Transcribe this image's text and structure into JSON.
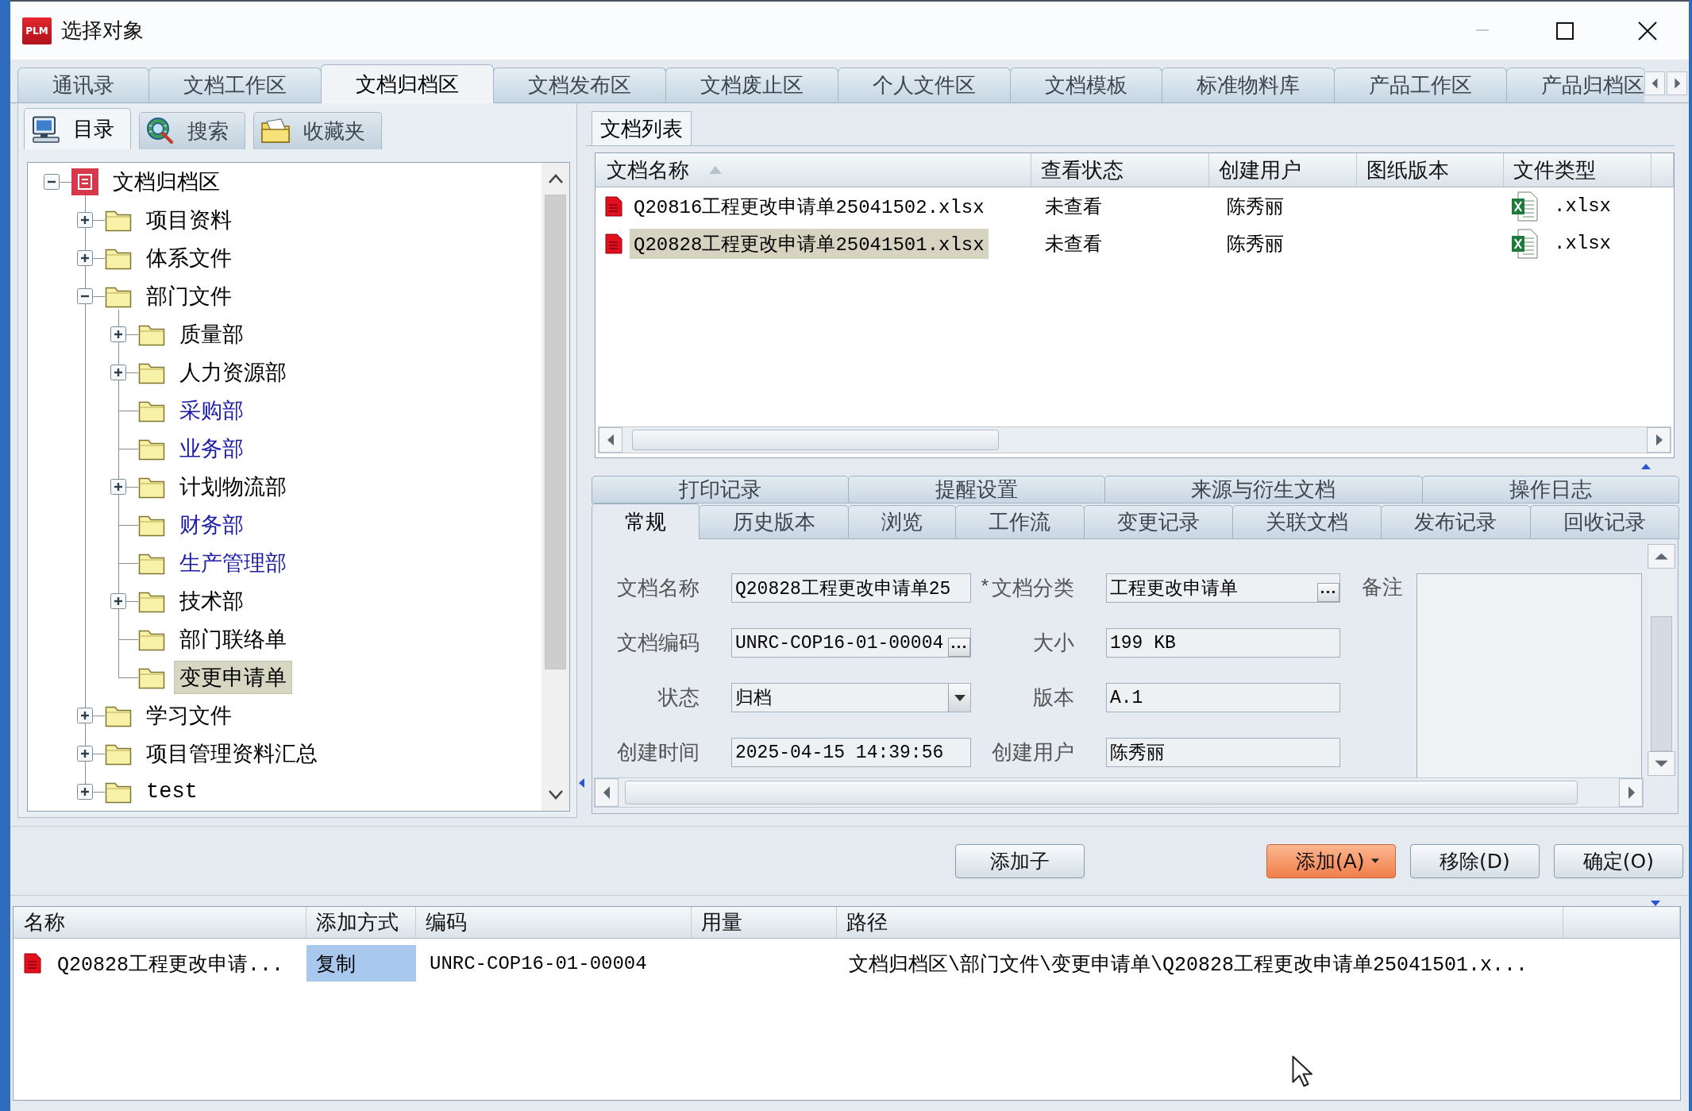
{
  "window": {
    "logo_text": "PLM",
    "title": "选择对象"
  },
  "main_tabs": [
    {
      "label": "通讯录",
      "selected": false
    },
    {
      "label": "文档工作区",
      "selected": false
    },
    {
      "label": "文档归档区",
      "selected": true
    },
    {
      "label": "文档发布区",
      "selected": false
    },
    {
      "label": "文档废止区",
      "selected": false
    },
    {
      "label": "个人文件区",
      "selected": false
    },
    {
      "label": "文档模板",
      "selected": false
    },
    {
      "label": "标准物料库",
      "selected": false
    },
    {
      "label": "产品工作区",
      "selected": false
    },
    {
      "label": "产品归档区",
      "selected": false
    }
  ],
  "navigator": {
    "tabs": [
      {
        "label": "目录",
        "kind": "catalog",
        "selected": true
      },
      {
        "label": "搜索",
        "kind": "search",
        "selected": false
      },
      {
        "label": "收藏夹",
        "kind": "favorites",
        "selected": false
      }
    ],
    "tree": [
      {
        "label": "文档归档区",
        "kind": "archive",
        "expanded": true,
        "selected": false,
        "color": "#000000",
        "children": [
          {
            "label": "项目资料",
            "kind": "folder",
            "expanded": false,
            "selected": false,
            "color": "#000000"
          },
          {
            "label": "体系文件",
            "kind": "folder",
            "expanded": false,
            "selected": false,
            "color": "#000000"
          },
          {
            "label": "部门文件",
            "kind": "folder",
            "expanded": true,
            "selected": false,
            "color": "#000000",
            "children": [
              {
                "label": "质量部",
                "kind": "folder",
                "expanded": false,
                "selected": false,
                "color": "#000000"
              },
              {
                "label": "人力资源部",
                "kind": "folder",
                "expanded": false,
                "selected": false,
                "color": "#000000"
              },
              {
                "label": "采购部",
                "kind": "folder",
                "selected": false,
                "color": "#1c1ca8"
              },
              {
                "label": "业务部",
                "kind": "folder",
                "selected": false,
                "color": "#1c1ca8"
              },
              {
                "label": "计划物流部",
                "kind": "folder",
                "expanded": false,
                "selected": false,
                "color": "#000000"
              },
              {
                "label": "财务部",
                "kind": "folder",
                "selected": false,
                "color": "#1c1ca8"
              },
              {
                "label": "生产管理部",
                "kind": "folder",
                "selected": false,
                "color": "#1c1ca8"
              },
              {
                "label": "技术部",
                "kind": "folder",
                "expanded": false,
                "selected": false,
                "color": "#000000"
              },
              {
                "label": "部门联络单",
                "kind": "folder",
                "selected": false,
                "color": "#000000"
              },
              {
                "label": "变更申请单",
                "kind": "folder",
                "selected": true,
                "color": "#000000"
              }
            ]
          },
          {
            "label": "学习文件",
            "kind": "folder",
            "expanded": false,
            "selected": false,
            "color": "#000000"
          },
          {
            "label": "项目管理资料汇总",
            "kind": "folder",
            "expanded": false,
            "selected": false,
            "color": "#000000"
          },
          {
            "label": "test",
            "kind": "folder",
            "expanded": false,
            "selected": false,
            "color": "#000000"
          }
        ]
      }
    ]
  },
  "document_list": {
    "tab_label": "文档列表",
    "columns": [
      {
        "label": "文档名称",
        "sorted": true
      },
      {
        "label": "查看状态",
        "sorted": false
      },
      {
        "label": "创建用户",
        "sorted": false
      },
      {
        "label": "图纸版本",
        "sorted": false
      },
      {
        "label": "文件类型",
        "sorted": false
      }
    ],
    "rows": [
      {
        "name": "Q20816工程更改申请单25041502.xlsx",
        "view_status": "未查看",
        "creator": "陈秀丽",
        "file_type": ".xlsx",
        "selected": false
      },
      {
        "name": "Q20828工程更改申请单25041501.xlsx",
        "view_status": "未查看",
        "creator": "陈秀丽",
        "file_type": ".xlsx",
        "selected": true
      }
    ]
  },
  "detail_tabs": {
    "back_row": [
      {
        "label": "打印记录",
        "selected": false
      },
      {
        "label": "提醒设置",
        "selected": false
      },
      {
        "label": "来源与衍生文档",
        "selected": false
      },
      {
        "label": "操作日志",
        "selected": false
      }
    ],
    "front_row": [
      {
        "label": "常规",
        "selected": true
      },
      {
        "label": "历史版本",
        "selected": false
      },
      {
        "label": "浏览",
        "selected": false
      },
      {
        "label": "工作流",
        "selected": false
      },
      {
        "label": "变更记录",
        "selected": false
      },
      {
        "label": "关联文档",
        "selected": false
      },
      {
        "label": "发布记录",
        "selected": false
      },
      {
        "label": "回收记录",
        "selected": false
      }
    ]
  },
  "detail_form": {
    "fields": [
      {
        "label": "文档名称",
        "value": "Q20828工程更改申请单25",
        "kind": "text"
      },
      {
        "label": "文档分类",
        "value": "工程更改申请单",
        "kind": "browse",
        "marker": "*"
      },
      {
        "label": "文档编码",
        "value": "UNRC-COP16-01-00004",
        "kind": "browse"
      },
      {
        "label": "大小",
        "value": "199 KB",
        "kind": "text"
      },
      {
        "label": "状态",
        "value": "归档",
        "kind": "dropdown"
      },
      {
        "label": "版本",
        "value": "A.1",
        "kind": "text"
      },
      {
        "label": "创建时间",
        "value": "2025-04-15 14:39:56",
        "kind": "text"
      },
      {
        "label": "创建用户",
        "value": "陈秀丽",
        "kind": "text"
      }
    ],
    "remarks": {
      "label": "备注"
    }
  },
  "button_bar": {
    "buttons": [
      {
        "label": "添加子",
        "kind": "plain",
        "emphasized": false
      },
      {
        "label": "添加(A)",
        "kind": "split",
        "emphasized": true
      },
      {
        "label": "移除(D)",
        "kind": "plain",
        "emphasized": false
      },
      {
        "label": "确定(O)",
        "kind": "plain",
        "emphasized": false
      }
    ]
  },
  "selection_list": {
    "columns": [
      {
        "label": "名称"
      },
      {
        "label": "添加方式"
      },
      {
        "label": "编码"
      },
      {
        "label": "用量"
      },
      {
        "label": "路径"
      }
    ],
    "rows": [
      {
        "name": "Q20828工程更改申请...",
        "method": "复制",
        "method_selected": true,
        "code": "UNRC-COP16-01-00004",
        "path": "文档归档区\\部门文件\\变更申请单\\Q20828工程更改申请单25041501.x..."
      }
    ]
  }
}
